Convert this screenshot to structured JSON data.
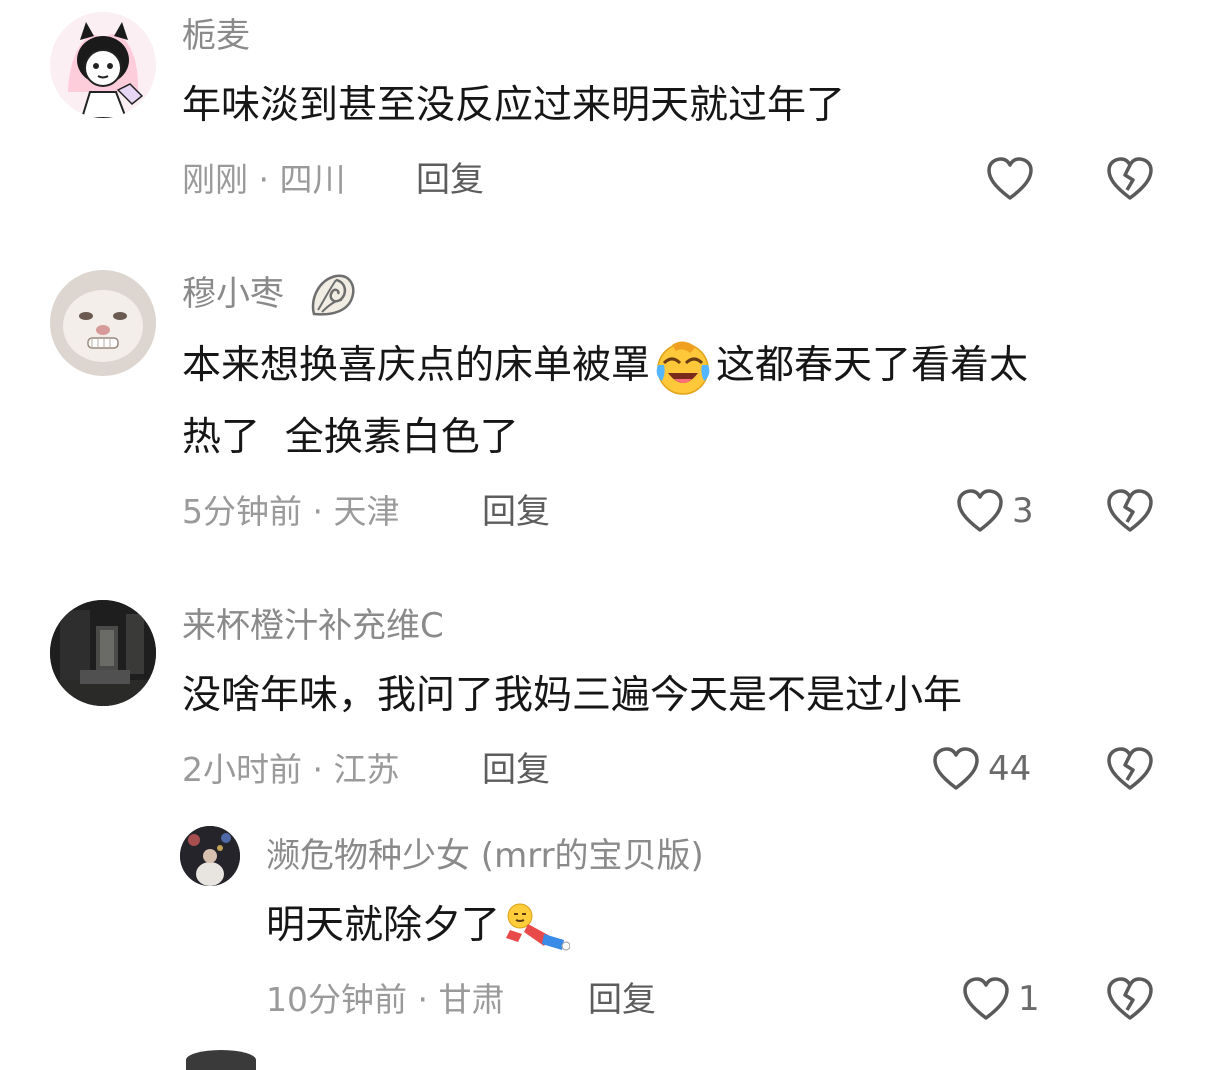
{
  "comments": [
    {
      "username": "栀麦",
      "text": "年味淡到甚至没反应过来明天就过年了",
      "meta": "刚刚 · 四川",
      "reply": "回复",
      "likes": ""
    },
    {
      "username": "穆小枣",
      "text_before": "本来想换喜庆点的床单被罩",
      "text_after": "这都春天了看着太",
      "text_line2": "热了  全换素白色了",
      "meta": "5分钟前 · 天津",
      "reply": "回复",
      "likes": "3"
    },
    {
      "username": "来杯橙汁补充维C",
      "text": "没啥年味，我问了我妈三遍今天是不是过小年",
      "meta": "2小时前 · 江苏",
      "reply": "回复",
      "likes": "44"
    }
  ],
  "subreply": {
    "username": "濒危物种少女 (mrr的宝贝版)",
    "text": "明天就除夕了",
    "meta": "10分钟前 · 甘肃",
    "reply": "回复",
    "likes": "1"
  },
  "icons": {
    "like": "heart-outline-icon",
    "dislike": "broken-heart-icon",
    "badge": "conch-shell-icon",
    "emoji1": "laughing-crying-emoji",
    "emoji2": "lying-down-emoji"
  }
}
